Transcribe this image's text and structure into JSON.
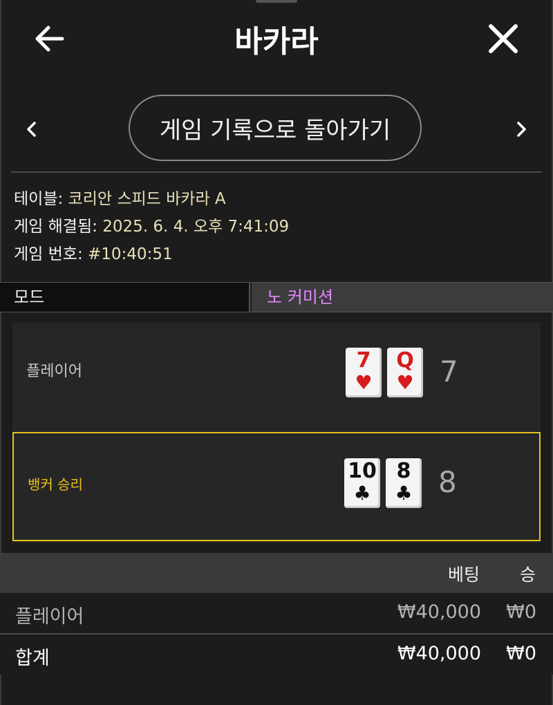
{
  "header": {
    "title": "바카라",
    "back_icon": "arrow-left-icon",
    "close_icon": "close-icon"
  },
  "nav": {
    "back_to_history_label": "게임 기록으로 돌아가기",
    "prev_icon": "chevron-left-icon",
    "next_icon": "chevron-right-icon"
  },
  "info": {
    "table_label": "테이블:",
    "table_value": "코리안 스피드 바카라 A",
    "resolved_label": "게임 해결됨:",
    "resolved_value": "2025. 6. 4. 오후 7:41:09",
    "game_no_label": "게임 번호:",
    "game_no_value": "#10:40:51"
  },
  "mode": {
    "label": "모드",
    "value": "노 커미션"
  },
  "hands": {
    "player": {
      "label": "플레이어",
      "cards": [
        {
          "rank": "7",
          "suit": "♥",
          "color": "red"
        },
        {
          "rank": "Q",
          "suit": "♥",
          "color": "red"
        }
      ],
      "score": "7"
    },
    "banker": {
      "label": "뱅커 승리",
      "cards": [
        {
          "rank": "10",
          "suit": "♣",
          "color": "black"
        },
        {
          "rank": "8",
          "suit": "♣",
          "color": "black"
        }
      ],
      "score": "8"
    }
  },
  "bets": {
    "headers": {
      "bet": "베팅",
      "win": "승"
    },
    "rows": [
      {
        "label": "플레이어",
        "bet": "₩40,000",
        "win": "₩0"
      }
    ],
    "total": {
      "label": "합계",
      "bet": "₩40,000",
      "win": "₩0"
    }
  },
  "colors": {
    "background": "#1c1c1c",
    "accent_gold": "#e4c21c",
    "mode_value": "#e38aff",
    "info_value": "#e8e0b8"
  }
}
